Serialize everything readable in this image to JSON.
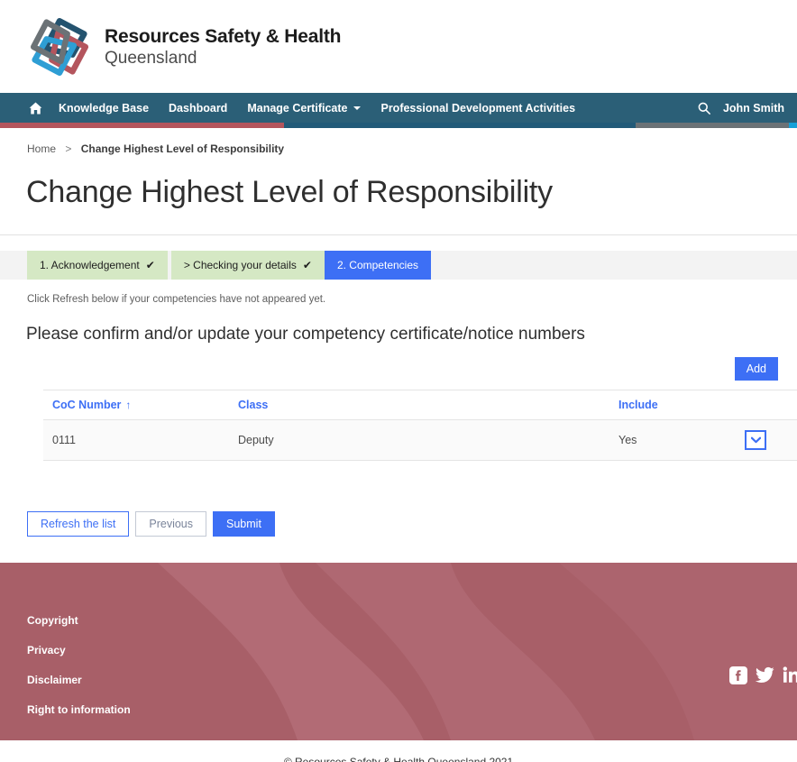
{
  "brand": {
    "line1": "Resources Safety & Health",
    "line2": "Queensland",
    "logo_icon": "rsq-diamond-logo",
    "colors": {
      "logo_navy": "#24536f",
      "logo_red": "#b4555d",
      "logo_gray": "#6b7276",
      "logo_cyan": "#2e9ed4"
    }
  },
  "nav": {
    "home_icon": "home-icon",
    "search_icon": "search-icon",
    "items": [
      {
        "label": "Knowledge Base",
        "has_caret": false
      },
      {
        "label": "Dashboard",
        "has_caret": false
      },
      {
        "label": "Manage Certificate",
        "has_caret": true
      },
      {
        "label": "Professional Development Activities",
        "has_caret": false
      }
    ],
    "user": "John Smith",
    "bg_color": "#2b5f77"
  },
  "accent": {
    "red": "#b4555d",
    "teal": "#225a78",
    "gray": "#6b7276",
    "cyan": "#16a0d8"
  },
  "breadcrumb": {
    "home": "Home",
    "separator": ">",
    "current": "Change Highest Level of Responsibility"
  },
  "page": {
    "title": "Change Highest Level of Responsibility",
    "hint": "Click Refresh below if your competencies have not appeared yet.",
    "section_heading": "Please confirm and/or update your competency certificate/notice numbers"
  },
  "steps": [
    {
      "label": "1. Acknowledgement",
      "tick": "✔",
      "state": "done"
    },
    {
      "label": "> Checking your details",
      "tick": "✔",
      "state": "done"
    },
    {
      "label": "2. Competencies",
      "tick": "",
      "state": "active"
    }
  ],
  "table": {
    "add_label": "Add",
    "columns": [
      {
        "label": "CoC Number",
        "sorted": true,
        "sort_arrow": "↑"
      },
      {
        "label": "Class",
        "sorted": false,
        "sort_arrow": ""
      },
      {
        "label": "Include",
        "sorted": false,
        "sort_arrow": ""
      }
    ],
    "rows": [
      {
        "coc_number": "0111",
        "class": "Deputy",
        "include": "Yes",
        "action_icon": "chevron-down-icon"
      }
    ]
  },
  "actions": {
    "refresh_label": "Refresh the list",
    "previous_label": "Previous",
    "submit_label": "Submit"
  },
  "footer": {
    "links": [
      {
        "label": "Copyright"
      },
      {
        "label": "Privacy"
      },
      {
        "label": "Disclaimer"
      },
      {
        "label": "Right to information"
      }
    ],
    "social": [
      {
        "name": "facebook-icon"
      },
      {
        "name": "twitter-icon"
      },
      {
        "name": "linkedin-icon"
      }
    ],
    "bg_color": "#a85f68",
    "copyright": "© Resources Safety & Health Queensland 2021"
  },
  "theme": {
    "primary_blue": "#3d6ff5",
    "step_done_green": "#d5e8c4"
  }
}
